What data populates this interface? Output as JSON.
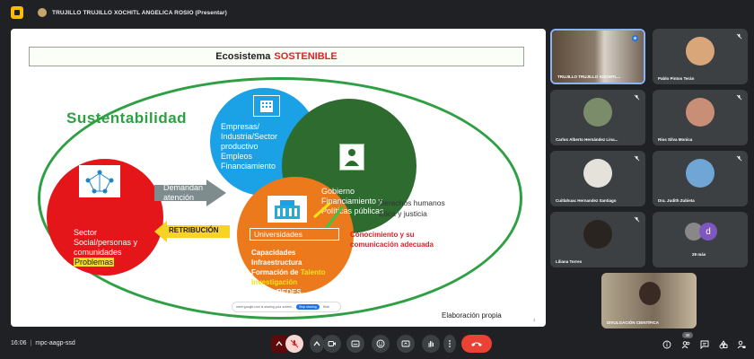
{
  "presenter": {
    "name": "TRUJILLO TRUJILLO XOCHITL ANGELICA ROSIO (Presentar)"
  },
  "slide": {
    "title_prefix": "Ecosistema",
    "title_accent": "SOSTENIBLE",
    "sustentabilidad": "Sustentabilidad",
    "empresas_lines": [
      "Empresas/",
      "Industria/Sector",
      "productivo",
      "Empleos",
      "Financiamiento"
    ],
    "gobierno_lines": [
      "Gobierno",
      "Financiamiento y",
      "Políticas públicas"
    ],
    "sector_lines": [
      "Sector",
      "Social/personas y",
      "comunidades"
    ],
    "sector_highlight": "Problemas",
    "demandan_lines": [
      "Demandan",
      "atención"
    ],
    "retribucion": "RETRIBUCIÓN",
    "universidades": "Universidades",
    "univ_items": [
      "Capacidades",
      "Infraestructura"
    ],
    "univ_formacion_prefix": "Formación de ",
    "univ_formacion_accent": "Talento",
    "univ_investigacion": "Investigación",
    "univ_redes": "REDES",
    "derechos_lines": [
      "Derechos humanos",
      "Ética y justicia"
    ],
    "conocimiento_lines": [
      "Conocimiento y su",
      "comunicación adecuada"
    ],
    "share_toast_text": "meet.google.com is sharing your screen.",
    "share_toast_stop": "Stop sharing",
    "share_toast_hide": "Hide",
    "elaboracion": "Elaboración propia",
    "page_number": "3"
  },
  "participants": [
    {
      "name": "TRUJILLO TRUJILLO XOCHITL...",
      "active": true
    },
    {
      "name": "Pablo Pintos Terán"
    },
    {
      "name": "Carlos Alberto Hernández Lina..."
    },
    {
      "name": "Ríos Silva Monica"
    },
    {
      "name": "Cuitlahuac Hernandez Santiago"
    },
    {
      "name": "Dra. Judith Zubieta"
    },
    {
      "name": "Liliana Torres"
    },
    {
      "name": "29 más"
    },
    {
      "name": "DIVULGACIÓN CIENTÍFICA"
    }
  ],
  "more_avatar_letter": "d",
  "bottom": {
    "time": "16:06",
    "meeting_code": "mpc-aagp-ssd",
    "people_badge": "38"
  },
  "colors": {
    "red_circle": "#e4161a",
    "blue_circle": "#1ba1e6",
    "green_circle": "#2d6b2f",
    "orange_circle": "#ec7a1c",
    "oval_border": "#2ea043",
    "end_call": "#ea4335"
  }
}
